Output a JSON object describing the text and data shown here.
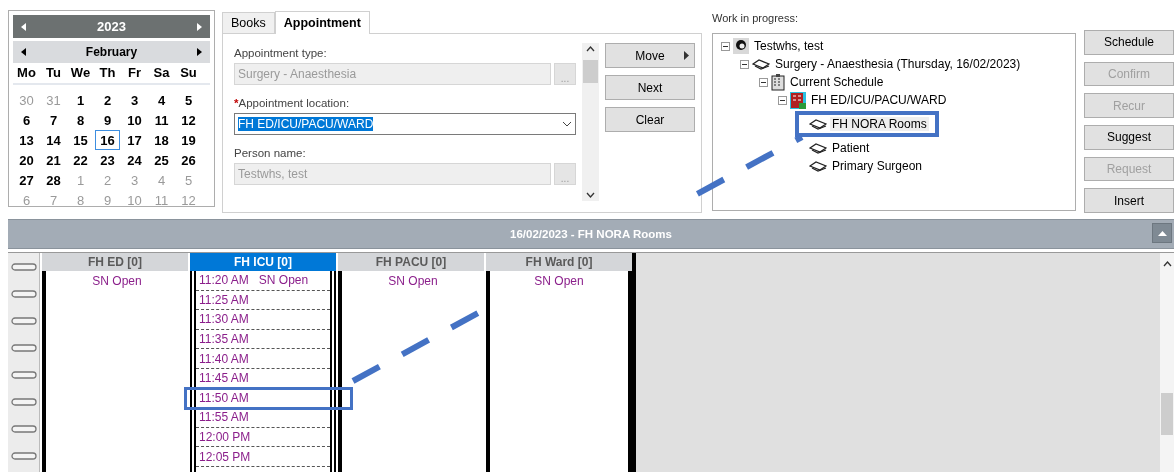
{
  "calendar": {
    "year": "2023",
    "month": "February",
    "weekdays": [
      "Mo",
      "Tu",
      "We",
      "Th",
      "Fr",
      "Sa",
      "Su"
    ],
    "days": [
      {
        "label": "30",
        "in_month": false,
        "selected": false
      },
      {
        "label": "31",
        "in_month": false,
        "selected": false
      },
      {
        "label": "1",
        "in_month": true,
        "selected": false
      },
      {
        "label": "2",
        "in_month": true,
        "selected": false
      },
      {
        "label": "3",
        "in_month": true,
        "selected": false
      },
      {
        "label": "4",
        "in_month": true,
        "selected": false
      },
      {
        "label": "5",
        "in_month": true,
        "selected": false
      },
      {
        "label": "6",
        "in_month": true,
        "selected": false
      },
      {
        "label": "7",
        "in_month": true,
        "selected": false
      },
      {
        "label": "8",
        "in_month": true,
        "selected": false
      },
      {
        "label": "9",
        "in_month": true,
        "selected": false
      },
      {
        "label": "10",
        "in_month": true,
        "selected": false
      },
      {
        "label": "11",
        "in_month": true,
        "selected": false
      },
      {
        "label": "12",
        "in_month": true,
        "selected": false
      },
      {
        "label": "13",
        "in_month": true,
        "selected": false
      },
      {
        "label": "14",
        "in_month": true,
        "selected": false
      },
      {
        "label": "15",
        "in_month": true,
        "selected": false
      },
      {
        "label": "16",
        "in_month": true,
        "selected": true
      },
      {
        "label": "17",
        "in_month": true,
        "selected": false
      },
      {
        "label": "18",
        "in_month": true,
        "selected": false
      },
      {
        "label": "19",
        "in_month": true,
        "selected": false
      },
      {
        "label": "20",
        "in_month": true,
        "selected": false
      },
      {
        "label": "21",
        "in_month": true,
        "selected": false
      },
      {
        "label": "22",
        "in_month": true,
        "selected": false
      },
      {
        "label": "23",
        "in_month": true,
        "selected": false
      },
      {
        "label": "24",
        "in_month": true,
        "selected": false
      },
      {
        "label": "25",
        "in_month": true,
        "selected": false
      },
      {
        "label": "26",
        "in_month": true,
        "selected": false
      },
      {
        "label": "27",
        "in_month": true,
        "selected": false
      },
      {
        "label": "28",
        "in_month": true,
        "selected": false
      },
      {
        "label": "1",
        "in_month": false,
        "selected": false
      },
      {
        "label": "2",
        "in_month": false,
        "selected": false
      },
      {
        "label": "3",
        "in_month": false,
        "selected": false
      },
      {
        "label": "4",
        "in_month": false,
        "selected": false
      },
      {
        "label": "5",
        "in_month": false,
        "selected": false
      },
      {
        "label": "6",
        "in_month": false,
        "selected": false
      },
      {
        "label": "7",
        "in_month": false,
        "selected": false
      },
      {
        "label": "8",
        "in_month": false,
        "selected": false
      },
      {
        "label": "9",
        "in_month": false,
        "selected": false
      },
      {
        "label": "10",
        "in_month": false,
        "selected": false
      },
      {
        "label": "11",
        "in_month": false,
        "selected": false
      },
      {
        "label": "12",
        "in_month": false,
        "selected": false
      }
    ]
  },
  "tabs": [
    {
      "label": "Books",
      "selected": false
    },
    {
      "label": "Appointment",
      "selected": true
    }
  ],
  "form": {
    "fields": [
      {
        "kind": "lookup",
        "label": "Appointment type:",
        "value": "Surgery - Anaesthesia",
        "disabled": true,
        "required": false,
        "browse": "..."
      },
      {
        "kind": "dropdown",
        "label": "Appointment location:",
        "value": "FH ED/ICU/PACU/WARD",
        "disabled": false,
        "required": true,
        "required_mark": "*"
      },
      {
        "kind": "lookup",
        "label": "Person name:",
        "value": "Testwhs, test",
        "disabled": true,
        "required": false,
        "browse": "..."
      }
    ],
    "buttons": [
      {
        "label": "Move",
        "menu": true
      },
      {
        "label": "Next",
        "menu": false
      },
      {
        "label": "Clear",
        "menu": false
      }
    ]
  },
  "work_in_progress": {
    "label": "Work in progress:",
    "tree": [
      {
        "kind": "person",
        "label": "Testwhs, test",
        "expanded": true,
        "selected": false,
        "children": [
          {
            "kind": "resource",
            "label": "Surgery - Anaesthesia (Thursday, 16/02/2023)",
            "expanded": true,
            "selected": false,
            "children": [
              {
                "kind": "schedule",
                "label": "Current Schedule",
                "expanded": true,
                "selected": false,
                "children": [
                  {
                    "kind": "location",
                    "label": "FH ED/ICU/PACU/WARD",
                    "expanded": true,
                    "selected": false,
                    "children": [
                      {
                        "kind": "resource",
                        "label": "FH NORA Rooms",
                        "selected": true
                      },
                      {
                        "kind": "resource",
                        "label": "Patient",
                        "selected": false
                      },
                      {
                        "kind": "resource",
                        "label": "Primary Surgeon",
                        "selected": false
                      }
                    ]
                  }
                ]
              }
            ]
          }
        ]
      }
    ]
  },
  "side_buttons": [
    {
      "label": "Schedule",
      "disabled": false
    },
    {
      "label": "Confirm",
      "disabled": true
    },
    {
      "label": "Recur",
      "disabled": true
    },
    {
      "label": "Suggest",
      "disabled": false
    },
    {
      "label": "Request",
      "disabled": true
    },
    {
      "label": "Insert",
      "disabled": false
    }
  ],
  "schedule": {
    "title": "16/02/2023 - FH NORA Rooms",
    "columns": [
      {
        "title": "FH ED [0]",
        "selected": false,
        "note": "SN Open"
      },
      {
        "title": "FH ICU [0]",
        "selected": true,
        "slots": [
          {
            "time": "11:20 AM",
            "note": "SN Open"
          },
          {
            "time": "11:25 AM"
          },
          {
            "time": "11:30 AM"
          },
          {
            "time": "11:35 AM"
          },
          {
            "time": "11:40 AM"
          },
          {
            "time": "11:45 AM"
          },
          {
            "time": "11:50 AM"
          },
          {
            "time": "11:55 AM"
          },
          {
            "time": "12:00 PM"
          },
          {
            "time": "12:05 PM"
          }
        ]
      },
      {
        "title": "FH PACU [0]",
        "selected": false,
        "note": "SN Open"
      },
      {
        "title": "FH Ward [0]",
        "selected": false,
        "note": "SN Open"
      }
    ]
  }
}
